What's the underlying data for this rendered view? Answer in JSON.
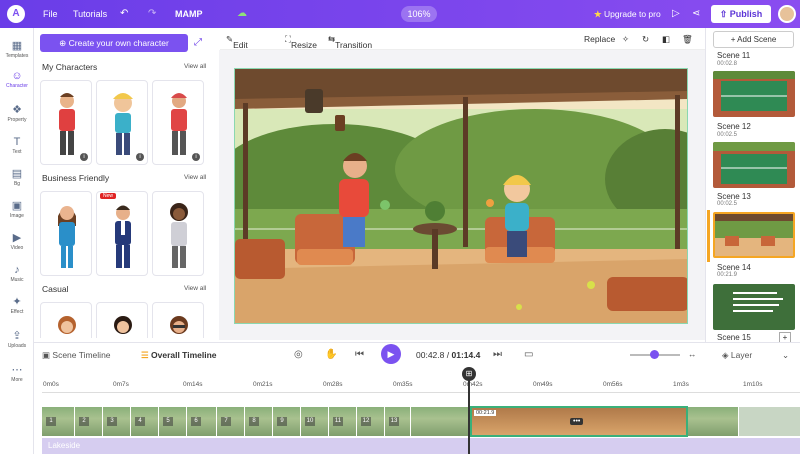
{
  "topbar": {
    "logo": "A",
    "menu_file": "File",
    "menu_tutorials": "Tutorials",
    "undo_icon": "↶",
    "redo_icon": "↷",
    "project_name": "MAMP",
    "zoom": "106%",
    "upgrade_star": "★",
    "upgrade_label": "Upgrade to pro",
    "publish_label": "Publish",
    "accent": "#6a3de8"
  },
  "rail": [
    {
      "icon": "▦",
      "label": "Templates"
    },
    {
      "icon": "☺",
      "label": "Character"
    },
    {
      "icon": "❖",
      "label": "Property"
    },
    {
      "icon": "T",
      "label": "Text"
    },
    {
      "icon": "▤",
      "label": "Bg"
    },
    {
      "icon": "▣",
      "label": "Image"
    },
    {
      "icon": "▶",
      "label": "Video"
    },
    {
      "icon": "♪",
      "label": "Music"
    },
    {
      "icon": "✦",
      "label": "Effect"
    },
    {
      "icon": "⇪",
      "label": "Uploads"
    },
    {
      "icon": "⋯",
      "label": "More"
    }
  ],
  "panel": {
    "create_label": "Create your own character",
    "sections": [
      {
        "title": "My Characters",
        "view_all": "View all"
      },
      {
        "title": "Business Friendly",
        "view_all": "View all"
      },
      {
        "title": "Casual",
        "view_all": "View all"
      }
    ],
    "new_badge": "New"
  },
  "toolbar": {
    "edit_image": "Edit Image",
    "resize": "Resize",
    "transition": "Transition",
    "replace": "Replace"
  },
  "scenes": [
    {
      "name": "Scene 11",
      "time": "00:02.8"
    },
    {
      "name": "Scene 12",
      "time": "00:02.5"
    },
    {
      "name": "Scene 13",
      "time": "00:02.5"
    },
    {
      "name": "Scene 14",
      "time": "00:21.9"
    },
    {
      "name": "Scene 15",
      "time": ""
    }
  ],
  "add_scene": "+ Add Scene",
  "timeline": {
    "scene_timeline": "Scene Timeline",
    "overall_timeline": "Overall Timeline",
    "current_time": "00:42.8",
    "separator": "/",
    "total_time": "01:14.4",
    "layer_label": "Layer",
    "ticks": [
      "0m0s",
      "0m7s",
      "0m14s",
      "0m21s",
      "0m28s",
      "0m35s",
      "0m42s",
      "0m49s",
      "0m56s",
      "1m3s",
      "1m10s"
    ],
    "segments": [
      "1",
      "2",
      "3",
      "4",
      "5",
      "6",
      "7",
      "8",
      "9",
      "10",
      "11",
      "12",
      "13",
      "",
      "15"
    ],
    "selected_duration": "00:21.9",
    "track_label": "Lakeside"
  }
}
